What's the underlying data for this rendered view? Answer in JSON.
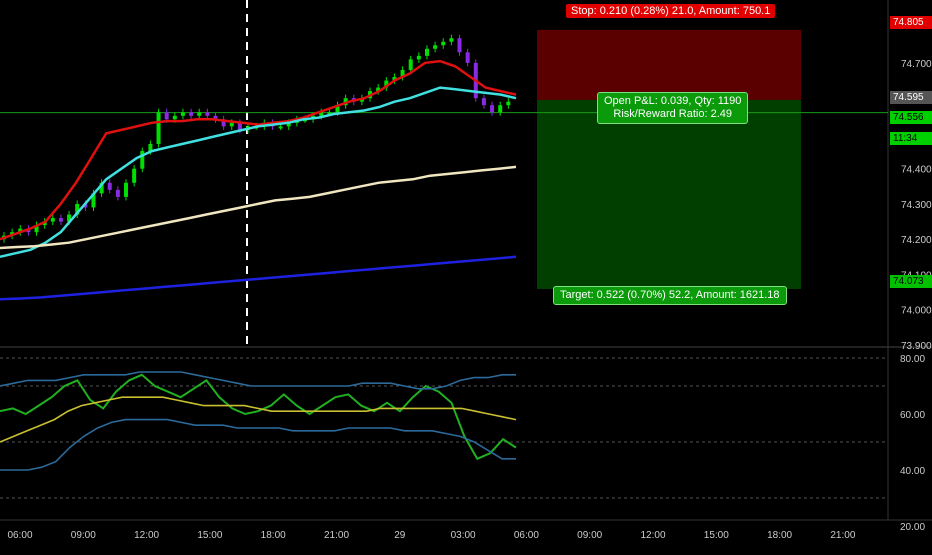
{
  "chart_data": [
    {
      "type": "line",
      "title": "",
      "x_ticks": [
        "06:00",
        "09:00",
        "12:00",
        "15:00",
        "18:00",
        "21:00",
        "29",
        "03:00",
        "06:00",
        "09:00",
        "12:00",
        "15:00",
        "18:00",
        "21:00"
      ],
      "y_ticks": [
        "74.805",
        "74.700",
        "74.595",
        "74.556",
        "74.400",
        "74.300",
        "74.200",
        "74.100",
        "74.073",
        "74.000",
        "73.900"
      ],
      "ylim": [
        73.9,
        74.85
      ],
      "candles_close": [
        74.21,
        74.22,
        74.23,
        74.22,
        74.24,
        74.25,
        74.26,
        74.25,
        74.27,
        74.3,
        74.29,
        74.33,
        74.36,
        74.34,
        74.32,
        74.36,
        74.4,
        74.45,
        74.47,
        74.56,
        74.54,
        74.55,
        74.56,
        74.55,
        74.56,
        74.55,
        74.54,
        74.52,
        74.53,
        74.51,
        74.52,
        74.52,
        74.53,
        74.52,
        74.52,
        74.53,
        74.54,
        74.54,
        74.55,
        74.56,
        74.56,
        74.58,
        74.6,
        74.59,
        74.6,
        74.62,
        74.63,
        74.65,
        74.66,
        74.68,
        74.71,
        74.72,
        74.74,
        74.75,
        74.76,
        74.77,
        74.73,
        74.7,
        74.6,
        74.58,
        74.56,
        74.58,
        74.59
      ],
      "series": [
        {
          "name": "",
          "color": "#e01010",
          "values": [
            74.2,
            74.215,
            74.23,
            74.25,
            74.3,
            74.36,
            74.43,
            74.5,
            74.51,
            74.52,
            74.53,
            74.535,
            74.535,
            74.54,
            74.54,
            74.535,
            74.53,
            74.525,
            74.53,
            74.535,
            74.545,
            74.56,
            74.575,
            74.59,
            74.6,
            74.62,
            74.65,
            74.67,
            74.7,
            74.705,
            74.69,
            74.66,
            74.63,
            74.62,
            74.61
          ]
        },
        {
          "name": "",
          "color": "#40e0e0",
          "values": [
            74.15,
            74.16,
            74.17,
            74.19,
            74.22,
            74.27,
            74.32,
            74.37,
            74.4,
            74.43,
            74.45,
            74.46,
            74.47,
            74.48,
            74.49,
            74.5,
            74.51,
            74.52,
            74.525,
            74.53,
            74.54,
            74.545,
            74.555,
            74.56,
            74.565,
            74.575,
            74.59,
            74.6,
            74.615,
            74.63,
            74.625,
            74.62,
            74.615,
            74.61,
            74.6
          ]
        },
        {
          "name": "",
          "color": "#f0e6c0",
          "values": [
            74.175,
            74.178,
            74.18,
            74.185,
            74.19,
            74.2,
            74.21,
            74.22,
            74.23,
            74.24,
            74.25,
            74.26,
            74.27,
            74.28,
            74.29,
            74.3,
            74.31,
            74.315,
            74.32,
            74.33,
            74.34,
            74.35,
            74.36,
            74.365,
            74.37,
            74.38,
            74.385,
            74.39,
            74.395,
            74.4,
            74.405
          ]
        },
        {
          "name": "",
          "color": "#1e22e0",
          "values": [
            74.03,
            74.032,
            74.035,
            74.04,
            74.045,
            74.05,
            74.055,
            74.06,
            74.065,
            74.07,
            74.075,
            74.08,
            74.085,
            74.09,
            74.095,
            74.1,
            74.105,
            74.11,
            74.115,
            74.12,
            74.125,
            74.13,
            74.135,
            74.14,
            74.145,
            74.15
          ]
        }
      ],
      "position": {
        "stop_price": 74.805,
        "entry_price": 74.595,
        "current_price": 74.556,
        "target_price": 74.073
      }
    },
    {
      "type": "line",
      "title": "",
      "y_ticks": [
        "80.00",
        "60.00",
        "40.00",
        "20.00"
      ],
      "ylim": [
        20,
        80
      ],
      "hlines": [
        80,
        70,
        50,
        30
      ],
      "series": [
        {
          "name": "",
          "color": "#20b020",
          "values": [
            61,
            62,
            60,
            63,
            66,
            70,
            72,
            65,
            62,
            68,
            72,
            74,
            70,
            68,
            66,
            69,
            72,
            66,
            62,
            60,
            61,
            63,
            67,
            63,
            60,
            63,
            66,
            67,
            63,
            61,
            64,
            61,
            66,
            70,
            68,
            64,
            52,
            44,
            46,
            51,
            48
          ]
        },
        {
          "name": "",
          "color": "#c8c030",
          "values": [
            50,
            52,
            54,
            56,
            58,
            61,
            63,
            64,
            65,
            66,
            66,
            66,
            66,
            65,
            64,
            63,
            63,
            63,
            63,
            62,
            61,
            61,
            61,
            61,
            61,
            61,
            61,
            61,
            62,
            62,
            62,
            62,
            62,
            62,
            62,
            61,
            60,
            59,
            58
          ]
        },
        {
          "name": "",
          "color": "#2c6a9a",
          "values": [
            70,
            71,
            72,
            72,
            72,
            73,
            74,
            74,
            74,
            74,
            75,
            75,
            75,
            75,
            74,
            73,
            72,
            71,
            70,
            70,
            70,
            70,
            70,
            70,
            70,
            70,
            71,
            71,
            71,
            70,
            69,
            69,
            70,
            72,
            73,
            73,
            74,
            74
          ]
        },
        {
          "name": "",
          "color": "#2c6a9a",
          "values": [
            40,
            40,
            40,
            41,
            43,
            48,
            52,
            55,
            57,
            58,
            58,
            58,
            58,
            57,
            56,
            56,
            56,
            55,
            55,
            55,
            55,
            54,
            54,
            54,
            54,
            55,
            55,
            55,
            55,
            54,
            54,
            54,
            53,
            52,
            50,
            47,
            44,
            44
          ]
        }
      ]
    }
  ],
  "annotations": {
    "stop_label": "Stop: 0.210 (0.28%) 21.0, Amount: 750.1",
    "pnl_label_line1": "Open P&L: 0.039, Qty: 1190",
    "pnl_label_line2": "Risk/Reward Ratio: 2.49",
    "target_label": "Target: 0.522 (0.70%) 52.2, Amount: 1621.18",
    "countdown": "11:34"
  }
}
